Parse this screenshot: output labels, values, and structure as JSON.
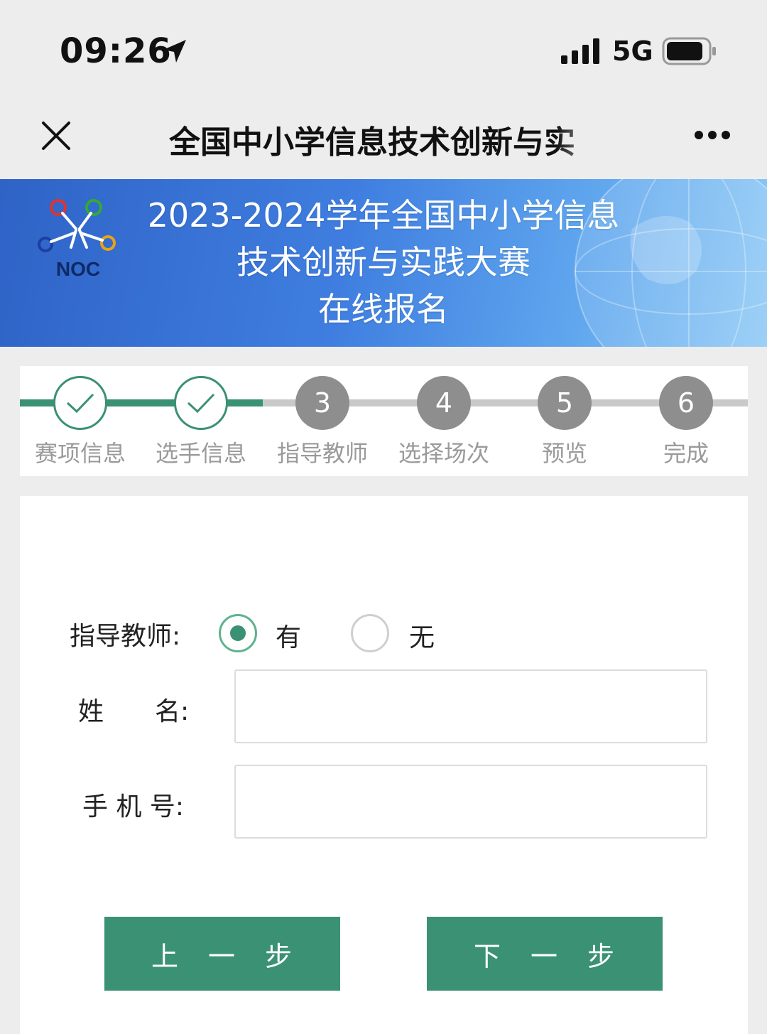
{
  "status_bar": {
    "time": "09:26",
    "network": "5G",
    "icons": [
      "location-arrow-icon",
      "signal-icon",
      "battery-icon"
    ]
  },
  "nav_bar": {
    "title": "全国中小学信息技术创新与实",
    "icons": [
      "close-icon",
      "more-icon"
    ]
  },
  "banner": {
    "logo_text": "NOC",
    "title_line1": "2023-2024学年全国中小学信息",
    "title_line2": "技术创新与实践大赛",
    "title_line3": "在线报名"
  },
  "stepper": {
    "steps": [
      {
        "number": "",
        "label": "赛项信息",
        "state": "done"
      },
      {
        "number": "",
        "label": "选手信息",
        "state": "done"
      },
      {
        "number": "3",
        "label": "指导教师",
        "state": "todo"
      },
      {
        "number": "4",
        "label": "选择场次",
        "state": "todo"
      },
      {
        "number": "5",
        "label": "预览",
        "state": "todo"
      },
      {
        "number": "6",
        "label": "完成",
        "state": "todo"
      }
    ],
    "colors": {
      "done": "#3a9173",
      "todo": "#8e8e8e"
    }
  },
  "form": {
    "teacher_label": "指导教师:",
    "option_yes": "有",
    "option_no": "无",
    "selected": "有",
    "name_label": "姓　　名:",
    "name_value": "",
    "phone_label": "手 机 号:",
    "phone_value": "",
    "prev_button": "上　一　步",
    "next_button": "下　一　步"
  },
  "colors": {
    "accent": "#3a9173",
    "banner": "#3f7ee0"
  }
}
